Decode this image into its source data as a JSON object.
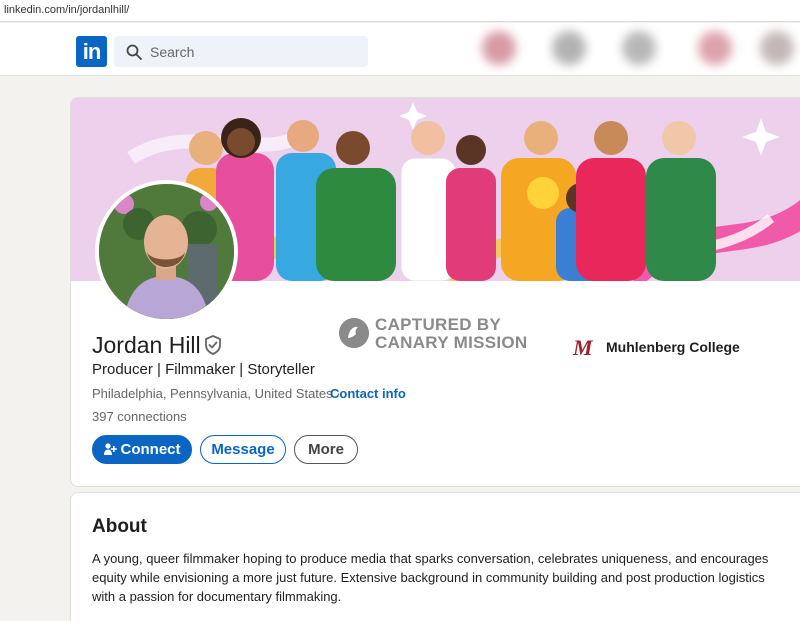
{
  "browser": {
    "url": "linkedin.com/in/jordanlhill/"
  },
  "nav": {
    "logo": "in",
    "search_placeholder": "Search"
  },
  "profile": {
    "name": "Jordan Hill",
    "headline": "Producer | Filmmaker | Storyteller",
    "location": "Philadelphia, Pennsylvania, United States · ",
    "contact_link": "Contact info",
    "connections": "397 connections",
    "buttons": {
      "connect": "Connect",
      "message": "Message",
      "more": "More"
    }
  },
  "watermark": {
    "line1": "CAPTURED BY",
    "line2": "CANARY MISSION"
  },
  "education": {
    "logo_letter": "M",
    "school": "Muhlenberg College"
  },
  "about": {
    "title": "About",
    "text": "A young, queer filmmaker hoping to produce media that sparks conversation, celebrates uniqueness, and encourages equity while envisioning a more just future. Extensive background in community building and post production logistics with a passion for documentary filmmaking."
  },
  "colors": {
    "brand": "#0a66c2",
    "banner": "#e9c9e9",
    "school": "#a3202b"
  }
}
